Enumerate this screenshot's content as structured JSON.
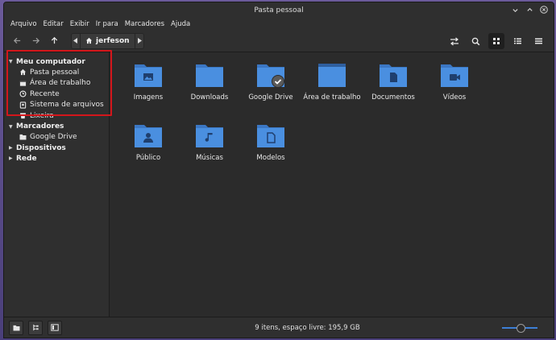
{
  "window": {
    "title": "Pasta pessoal"
  },
  "menu": [
    "Arquivo",
    "Editar",
    "Exibir",
    "Ir para",
    "Marcadores",
    "Ajuda"
  ],
  "path": {
    "current": "jerfeson"
  },
  "sidebar": {
    "sections": [
      {
        "label": "Meu computador",
        "expanded": true,
        "items": [
          {
            "label": "Pasta pessoal",
            "icon": "home-icon"
          },
          {
            "label": "Área de trabalho",
            "icon": "desktop-icon"
          },
          {
            "label": "Recente",
            "icon": "clock-icon"
          },
          {
            "label": "Sistema de arquivos",
            "icon": "drive-icon"
          },
          {
            "label": "Lixeira",
            "icon": "trash-icon"
          }
        ]
      },
      {
        "label": "Marcadores",
        "expanded": true,
        "items": [
          {
            "label": "Google Drive",
            "icon": "folder-icon"
          }
        ]
      },
      {
        "label": "Dispositivos",
        "expanded": false,
        "items": []
      },
      {
        "label": "Rede",
        "expanded": false,
        "items": []
      }
    ]
  },
  "files": [
    {
      "name": "Imagens",
      "emblem": "image"
    },
    {
      "name": "Downloads",
      "emblem": "none"
    },
    {
      "name": "Google Drive",
      "emblem": "check"
    },
    {
      "name": "Área de trabalho",
      "emblem": "desktop"
    },
    {
      "name": "Documentos",
      "emblem": "document"
    },
    {
      "name": "Vídeos",
      "emblem": "video"
    },
    {
      "name": "Público",
      "emblem": "person"
    },
    {
      "name": "Músicas",
      "emblem": "music"
    },
    {
      "name": "Modelos",
      "emblem": "template"
    }
  ],
  "status": {
    "text": "9 itens, espaço livre: 195,9 GB"
  },
  "zoom": {
    "level": 0.55
  },
  "colors": {
    "folder": "#4a8fe0",
    "folder_dark": "#3b77c4",
    "highlight": "#d4161b",
    "accent": "#3d7fd6"
  }
}
